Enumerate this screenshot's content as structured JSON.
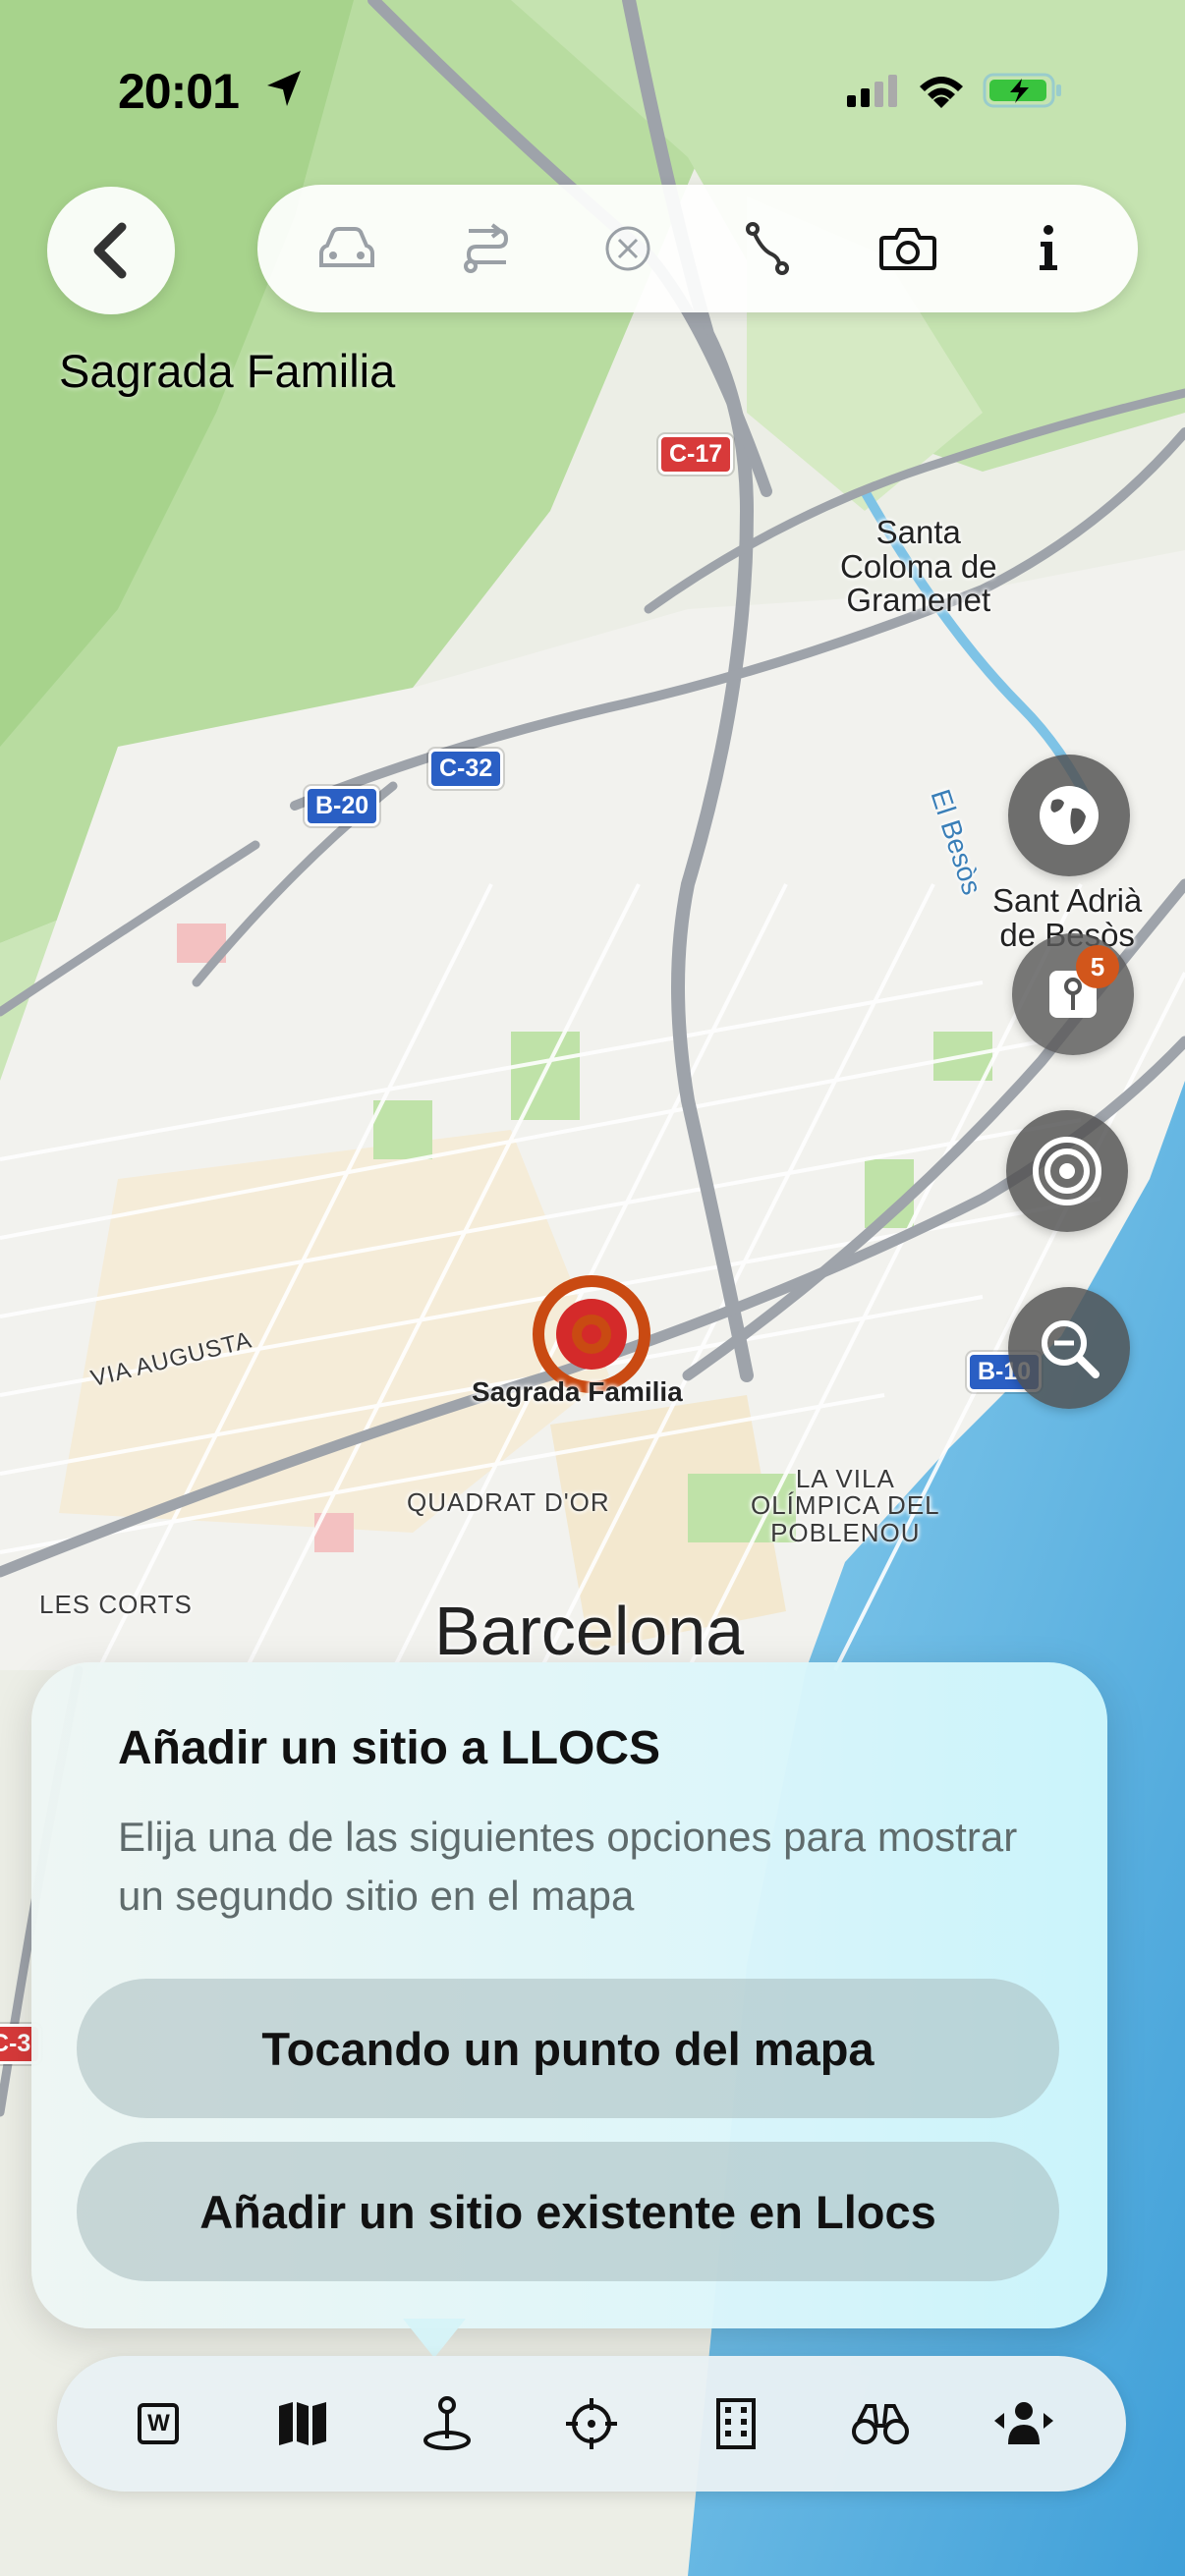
{
  "status_bar": {
    "time": "20:01"
  },
  "header": {
    "place_title": "Sagrada Familia"
  },
  "map": {
    "labels": {
      "santa_coloma": "Santa\nColoma de\nGramenet",
      "el_besos": "El Besòs",
      "sant_adria": "Sant Adrià\nde Besòs",
      "via_augusta": "VIA AUGUSTA",
      "marker_label": "Sagrada Familia",
      "quadrat_dor": "QUADRAT D'OR",
      "vila_olimpica": "LA VILA\nOLÍMPICA DEL\nPOBLENOU",
      "les_corts": "LES CORTS",
      "barcelona": "Barcelona"
    },
    "shields": {
      "c17": "C-17",
      "c32": "C-32",
      "b20": "B-20",
      "b10": "B-10",
      "c3": "C-3"
    }
  },
  "fab": {
    "places_badge": "5"
  },
  "panel": {
    "title": "Añadir un sitio a LLOCS",
    "subtitle": "Elija una de las siguientes opciones para mostrar un segundo sitio en el mapa",
    "option_1": "Tocando un punto del mapa",
    "option_2": "Añadir un sitio existente en Llocs"
  },
  "tabbar": {
    "w_label": "W"
  },
  "colors": {
    "accent_marker": "#c94a12",
    "marker_red": "#d42a2a",
    "badge": "#d2561b",
    "fab_bg": "#505050"
  }
}
